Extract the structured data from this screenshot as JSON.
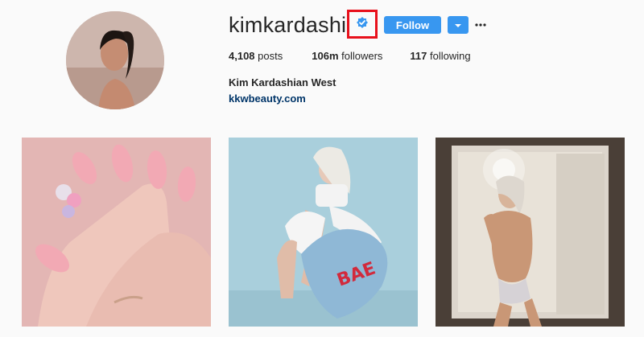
{
  "profile": {
    "username": "kimkardashian",
    "verified_icon": "verified-badge-icon",
    "follow_label": "Follow",
    "stats": {
      "posts_count": "4,108",
      "posts_label": "posts",
      "followers_count": "106m",
      "followers_label": "followers",
      "following_count": "117",
      "following_label": "following"
    },
    "full_name": "Kim Kardashian West",
    "website": "kkwbeauty.com"
  },
  "posts": [
    {
      "icon": "nails-photo",
      "caption_text": ""
    },
    {
      "icon": "bae-heart-photo",
      "caption_text": "BAE"
    },
    {
      "icon": "mirror-selfie-photo",
      "caption_text": ""
    }
  ],
  "colors": {
    "accent": "#3897f0",
    "highlight_box": "#e8101b",
    "link": "#003569",
    "background": "#fafafa"
  }
}
